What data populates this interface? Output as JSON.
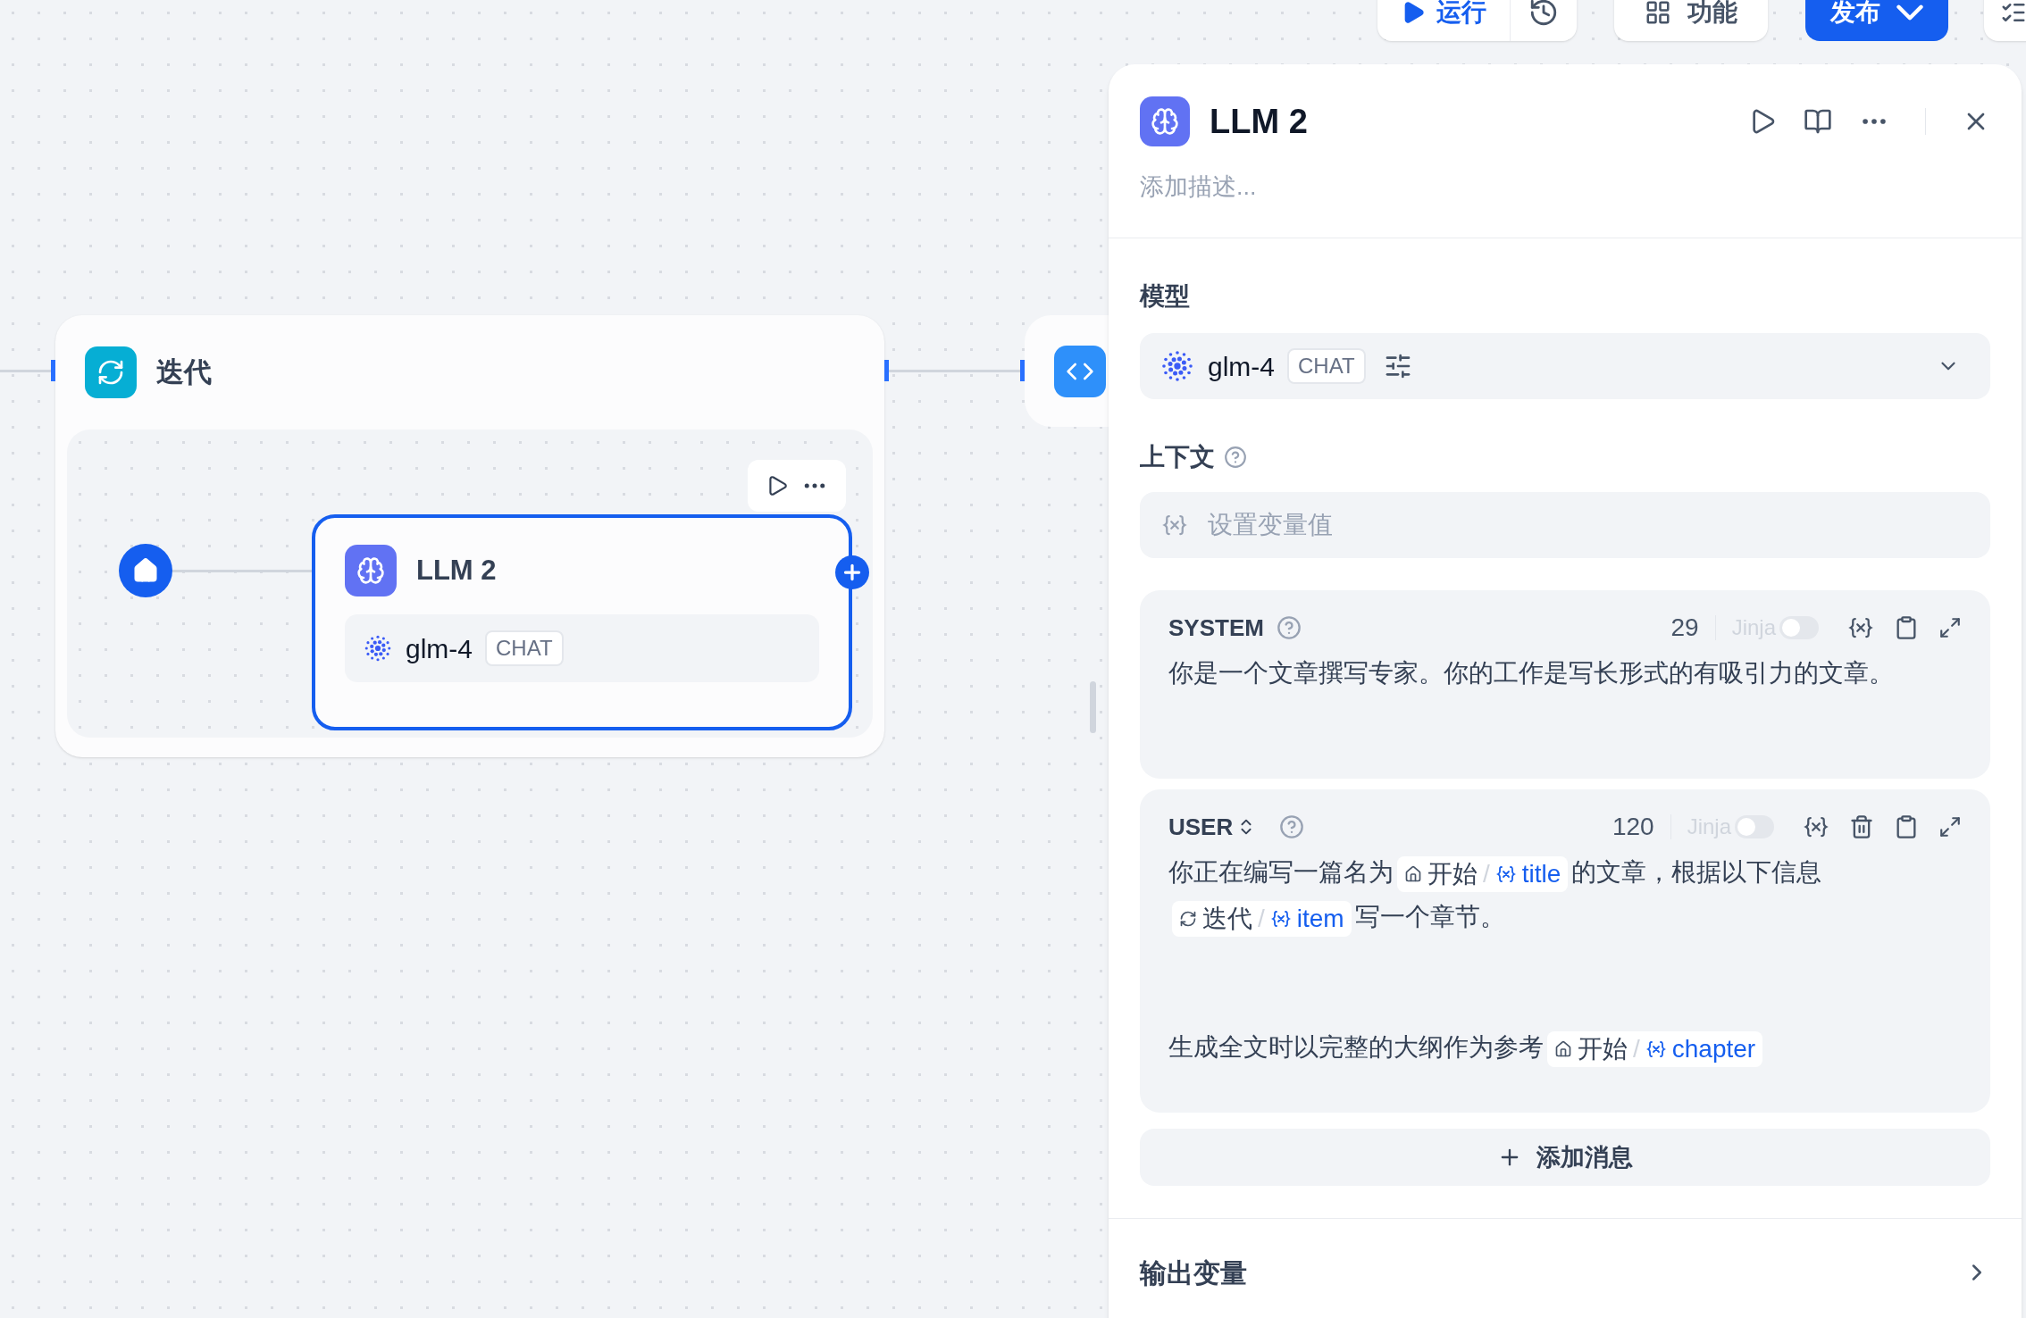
{
  "toolbar": {
    "run": "运行",
    "features": "功能",
    "publish": "发布"
  },
  "canvas": {
    "iteration_node": {
      "title": "迭代",
      "child_node": {
        "title": "LLM 2",
        "model": "glm-4",
        "badge": "CHAT",
        "selected": true
      }
    }
  },
  "panel": {
    "title": "LLM 2",
    "description_placeholder": "添加描述...",
    "model_label": "模型",
    "model": {
      "name": "glm-4",
      "badge": "CHAT"
    },
    "context_label": "上下文",
    "context_placeholder": "设置变量值",
    "messages": [
      {
        "role": "SYSTEM",
        "role_switchable": false,
        "count": "29",
        "jinja_label": "Jinja",
        "jinja_on": false,
        "deletable": false,
        "paragraphs": [
          [
            {
              "kind": "text",
              "text": "你是一个文章撰写专家。你的工作是写长形式的有吸引力的文章。"
            }
          ]
        ]
      },
      {
        "role": "USER",
        "role_switchable": true,
        "count": "120",
        "jinja_label": "Jinja",
        "jinja_on": false,
        "deletable": true,
        "paragraphs": [
          [
            {
              "kind": "text",
              "text": "你正在编写一篇名为"
            },
            {
              "kind": "var",
              "node": {
                "kind": "start",
                "name": "开始"
              },
              "separator": "/",
              "var": "title"
            },
            {
              "kind": "text",
              "text": "的文章，根据以下信息"
            },
            {
              "kind": "var",
              "node": {
                "kind": "iteration",
                "name": "迭代"
              },
              "separator": "/",
              "var": "item"
            },
            {
              "kind": "text",
              "text": "写一个章节。"
            }
          ],
          [
            {
              "kind": "text",
              "text": "生成全文时以完整的大纲作为参考"
            },
            {
              "kind": "var",
              "node": {
                "kind": "start",
                "name": "开始"
              },
              "separator": "/",
              "var": "chapter"
            }
          ]
        ]
      }
    ],
    "add_message": "添加消息",
    "output_label": "输出变量"
  }
}
